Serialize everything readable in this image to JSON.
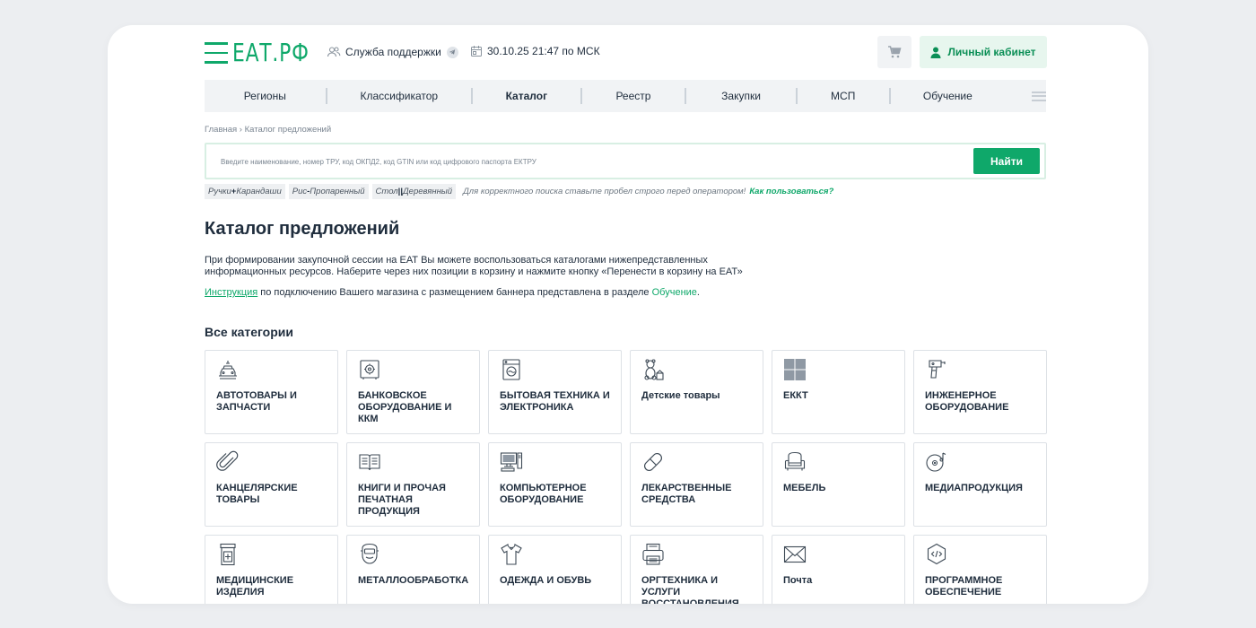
{
  "header": {
    "logo": "ЕАТ.РФ",
    "support_label": "Служба поддержки",
    "datetime": "30.10.25 21:47 по МСК",
    "cabinet_label": "Личный кабинет"
  },
  "nav": {
    "items": [
      {
        "label": "Регионы"
      },
      {
        "label": "Классификатор"
      },
      {
        "label": "Каталог",
        "active": true
      },
      {
        "label": "Реестр"
      },
      {
        "label": "Закупки"
      },
      {
        "label": "МСП"
      },
      {
        "label": "Обучение"
      }
    ]
  },
  "breadcrumb": "Главная › Каталог предложений",
  "search": {
    "placeholder": "Введите наименование, номер ТРУ, код ОКПД2, код GTIN или код цифрового паспорта ЕКТРУ",
    "button_label": "Найти"
  },
  "hints": {
    "chips": [
      {
        "left": "Ручки",
        "op": "+",
        "right": "Карандаши"
      },
      {
        "left": "Рис",
        "op": "-",
        "right": "Пропаренный"
      },
      {
        "left": "Стол",
        "op": "||",
        "right": "Деревянный"
      }
    ],
    "note": "Для корректного поиска ставьте пробел строго перед оператором!",
    "how_link": "Как пользоваться?"
  },
  "page": {
    "title": "Каталог предложений",
    "intro": "При формировании закупочной сессии на ЕАТ Вы можете воспользоваться каталогами нижепредставленных информационных ресурсов. Наберите через них позиции в корзину и нажмите кнопку «Перенести в корзину на ЕАТ»",
    "instruction_link": "Инструкция",
    "instruction_text": " по подключению Вашего магазина с размещением баннера представлена в разделе ",
    "instruction_section": "Обучение",
    "instruction_end": ".",
    "categories_title": "Все категории"
  },
  "categories": [
    {
      "label": "АВТОТОВАРЫ И ЗАПЧАСТИ",
      "icon": "car-icon"
    },
    {
      "label": "БАНКОВСКОЕ ОБОРУДОВАНИЕ И ККМ",
      "icon": "safe-icon"
    },
    {
      "label": "БЫТОВАЯ ТЕХНИКА И ЭЛЕКТРОНИКА",
      "icon": "washing-machine-icon"
    },
    {
      "label": "Детские товары",
      "icon": "teddy-bear-icon"
    },
    {
      "label": "ЕККТ",
      "icon": "grid-squares-icon"
    },
    {
      "label": "ИНЖЕНЕРНОЕ ОБОРУДОВАНИЕ",
      "icon": "drill-icon"
    },
    {
      "label": "КАНЦЕЛЯРСКИЕ ТОВАРЫ",
      "icon": "paperclip-icon"
    },
    {
      "label": "КНИГИ И ПРОЧАЯ ПЕЧАТНАЯ ПРОДУКЦИЯ",
      "icon": "book-icon"
    },
    {
      "label": "КОМПЬЮТЕРНОЕ ОБОРУДОВАНИЕ",
      "icon": "computer-icon"
    },
    {
      "label": "ЛЕКАРСТВЕННЫЕ СРЕДСТВА",
      "icon": "pill-icon"
    },
    {
      "label": "МЕБЕЛЬ",
      "icon": "armchair-icon"
    },
    {
      "label": "МЕДИАПРОДУКЦИЯ",
      "icon": "disc-icon"
    },
    {
      "label": "МЕДИЦИНСКИЕ ИЗДЕЛИЯ",
      "icon": "medicine-jar-icon"
    },
    {
      "label": "МЕТАЛЛООБРАБОТКА",
      "icon": "welding-mask-icon"
    },
    {
      "label": "ОДЕЖДА И ОБУВЬ",
      "icon": "shirt-icon"
    },
    {
      "label": "ОРГТЕХНИКА И УСЛУГИ ВОССТАНОВЛЕНИЯ",
      "icon": "printer-icon"
    },
    {
      "label": "Почта",
      "icon": "envelope-icon"
    },
    {
      "label": "ПРОГРАММНОЕ ОБЕСПЕЧЕНИЕ",
      "icon": "code-icon"
    }
  ],
  "colors": {
    "brand": "#0fa86a",
    "nav_bg": "#f1f3f5",
    "text": "#1f2d3d"
  }
}
